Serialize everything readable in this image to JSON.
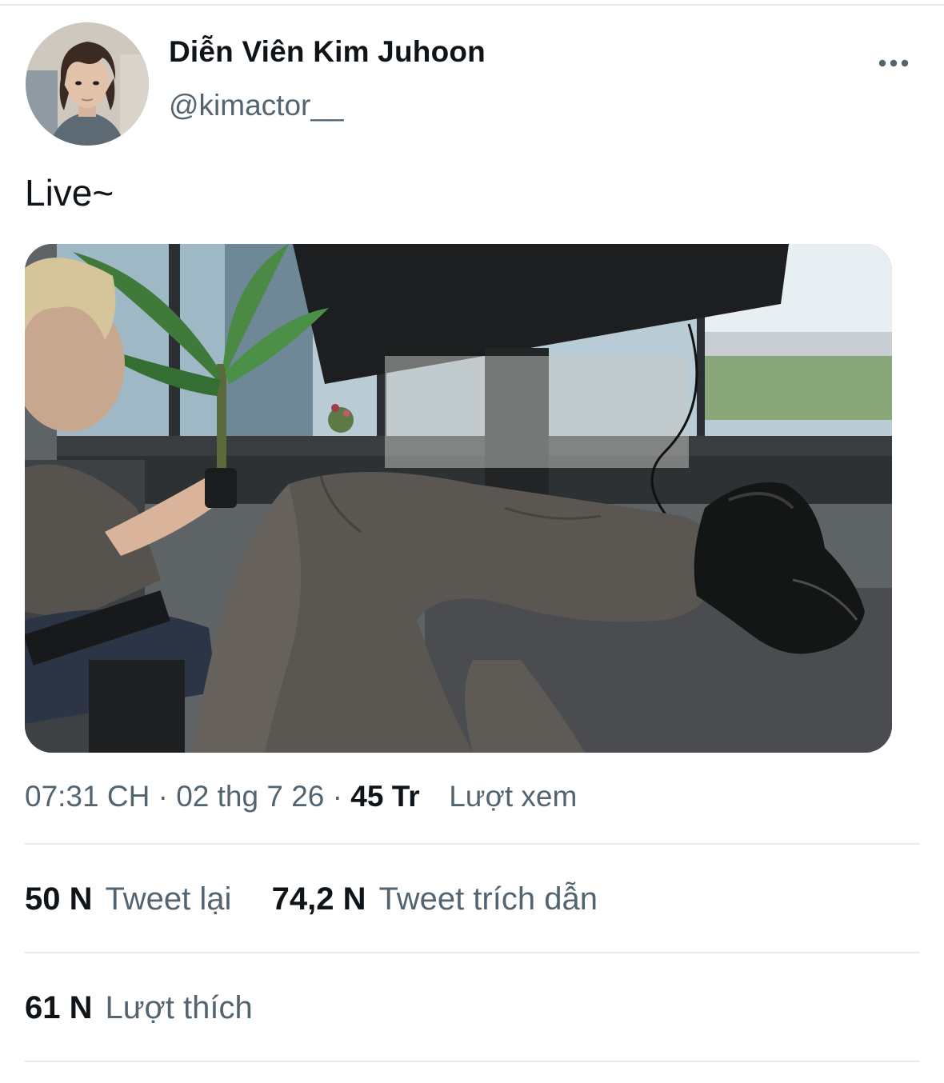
{
  "author": {
    "display_name": "Diễn Viên Kim Juhoon",
    "handle": "@kimactor__"
  },
  "tweet": {
    "text": "Live~",
    "time": "07:31 CH",
    "date": "02 thg 7 26",
    "separator": "·",
    "views_count": "45 Tr",
    "views_label": "Lượt xem"
  },
  "stats": {
    "retweets_count": "50 N",
    "retweets_label": "Tweet lại",
    "quotes_count": "74,2 N",
    "quotes_label": "Tweet trích dẫn",
    "likes_count": "61 N",
    "likes_label": "Lượt thích"
  },
  "icons": {
    "more": "more-horizontal-icon"
  },
  "colors": {
    "text_primary": "#0f1419",
    "text_secondary": "#536471",
    "divider": "#e7eaec"
  }
}
